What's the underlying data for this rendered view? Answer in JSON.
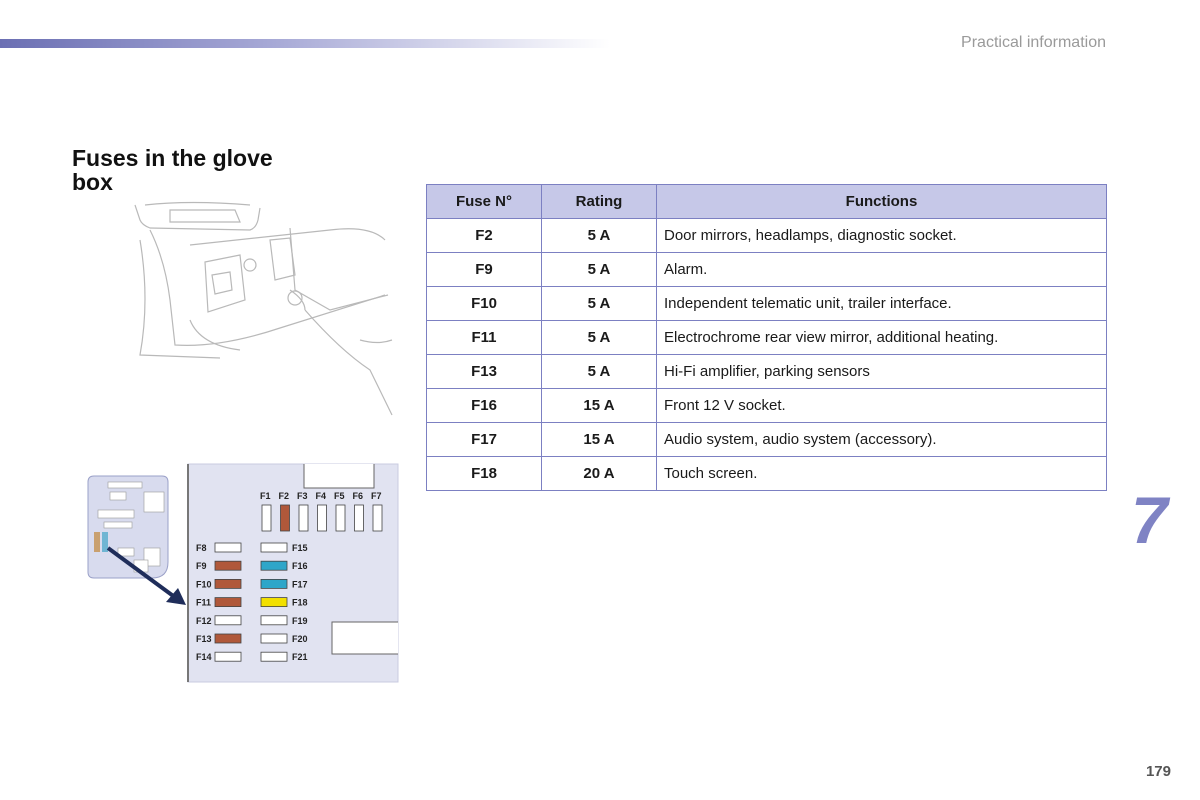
{
  "header": {
    "section": "Practical information"
  },
  "title": "Fuses in the glove box",
  "table": {
    "headers": [
      "Fuse N°",
      "Rating",
      "Functions"
    ],
    "rows": [
      {
        "fuse": "F2",
        "rating": "5 A",
        "function": "Door mirrors, headlamps, diagnostic socket."
      },
      {
        "fuse": "F9",
        "rating": "5 A",
        "function": "Alarm."
      },
      {
        "fuse": "F10",
        "rating": "5 A",
        "function": "Independent telematic unit, trailer interface."
      },
      {
        "fuse": "F11",
        "rating": "5 A",
        "function": "Electrochrome rear view mirror, additional heating."
      },
      {
        "fuse": "F13",
        "rating": "5 A",
        "function": "Hi-Fi amplifier, parking sensors"
      },
      {
        "fuse": "F16",
        "rating": "15 A",
        "function": "Front 12 V socket."
      },
      {
        "fuse": "F17",
        "rating": "15 A",
        "function": "Audio system, audio system (accessory)."
      },
      {
        "fuse": "F18",
        "rating": "20 A",
        "function": "Touch screen."
      }
    ]
  },
  "diagram": {
    "top_labels": [
      "F1",
      "F2",
      "F3",
      "F4",
      "F5",
      "F6",
      "F7"
    ],
    "left_labels": [
      "F8",
      "F9",
      "F10",
      "F11",
      "F12",
      "F13",
      "F14"
    ],
    "right_labels": [
      "F15",
      "F16",
      "F17",
      "F18",
      "F19",
      "F20",
      "F21"
    ],
    "colors": {
      "brown": "#b0583a",
      "blue": "#2ea6c9",
      "yellow": "#f2e000",
      "empty": "#ffffff"
    },
    "top_colors": [
      "empty",
      "brown",
      "empty",
      "empty",
      "empty",
      "empty",
      "empty"
    ],
    "left_colors": [
      "empty",
      "brown",
      "brown",
      "brown",
      "empty",
      "brown",
      "empty"
    ],
    "right_colors": [
      "empty",
      "blue",
      "blue",
      "yellow",
      "empty",
      "empty",
      "empty"
    ]
  },
  "chapter_number": "7",
  "page_number": "179"
}
